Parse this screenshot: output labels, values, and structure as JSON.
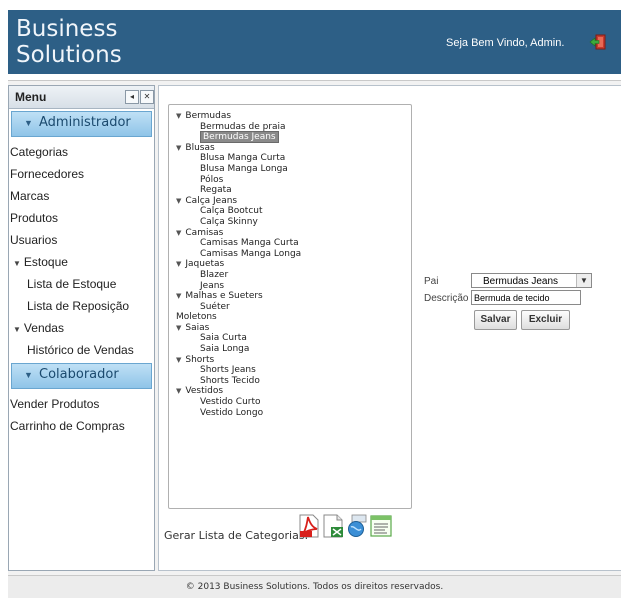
{
  "header": {
    "brand_line1": "Business",
    "brand_line2": "Solutions",
    "welcome": "Seja Bem Vindo, Admin."
  },
  "menu": {
    "title": "Menu",
    "sections": [
      {
        "label": "Administrador",
        "items": [
          {
            "label": "Categorias"
          },
          {
            "label": "Fornecedores"
          },
          {
            "label": "Marcas"
          },
          {
            "label": "Produtos"
          },
          {
            "label": "Usuarios"
          },
          {
            "label": "Estoque"
          },
          {
            "label": "Lista de Estoque"
          },
          {
            "label": "Lista de Reposição"
          },
          {
            "label": "Vendas"
          },
          {
            "label": "Histórico de Vendas"
          }
        ]
      },
      {
        "label": "Colaborador",
        "items": [
          {
            "label": "Vender Produtos"
          },
          {
            "label": "Carrinho de Compras"
          }
        ]
      }
    ]
  },
  "tree": {
    "nodes": [
      {
        "label": "Bermudas",
        "children": [
          "Bermudas de praia",
          "Bermudas Jeans"
        ]
      },
      {
        "label": "Blusas",
        "children": [
          "Blusa Manga Curta",
          "Blusa Manga Longa",
          "Pólos",
          "Regata"
        ]
      },
      {
        "label": "Calça Jeans",
        "children": [
          "Calça Bootcut",
          "Calça Skinny"
        ]
      },
      {
        "label": "Camisas",
        "children": [
          "Camisas Manga Curta",
          "Camisas Manga Longa"
        ]
      },
      {
        "label": "Jaquetas",
        "children": [
          "Blazer",
          "Jeans"
        ]
      },
      {
        "label": "Malhas e Sueters",
        "children": [
          "Suéter"
        ]
      },
      {
        "label": "Moletons",
        "children": []
      },
      {
        "label": "Saias",
        "children": [
          "Saia Curta",
          "Saia Longa"
        ]
      },
      {
        "label": "Shorts",
        "children": [
          "Shorts Jeans",
          "Shorts Tecido"
        ]
      },
      {
        "label": "Vestidos",
        "children": [
          "Vestido Curto",
          "Vestido Longo"
        ]
      }
    ],
    "selected": "Bermudas Jeans"
  },
  "export": {
    "label": "Gerar Lista de Categorias:",
    "icons": [
      "pdf-icon",
      "excel-icon",
      "web-export-icon",
      "text-document-icon"
    ]
  },
  "form": {
    "pai_label": "Pai",
    "pai_value": "Bermudas Jeans",
    "descricao_label": "Descrição",
    "descricao_value": "Bermuda de tecido",
    "save_label": "Salvar",
    "delete_label": "Excluir"
  },
  "footer": {
    "text": "© 2013 Business Solutions. Todos os direitos reservados."
  },
  "colors": {
    "header_bg": "#2d5f86",
    "section_head": "#8fc4e8",
    "selected_node": "#8a8a8a"
  }
}
